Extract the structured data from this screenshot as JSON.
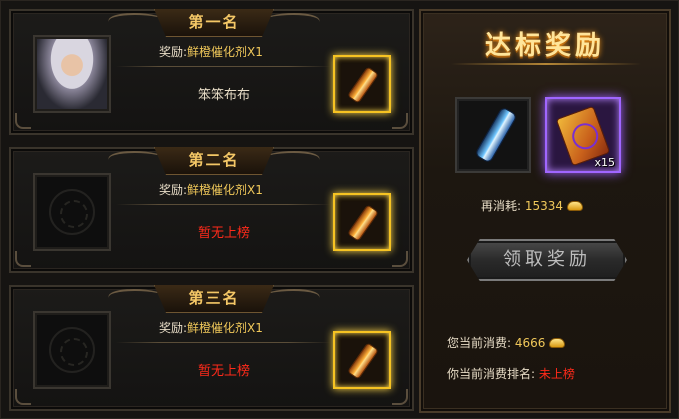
{
  "ranks": [
    {
      "title": "第一名",
      "reward_label": "奖励:",
      "reward_value": "鲜橙催化剂X1",
      "player": "笨笨布布",
      "has_player": true
    },
    {
      "title": "第二名",
      "reward_label": "奖励:",
      "reward_value": "鲜橙催化剂X1",
      "player": "暂无上榜",
      "has_player": false
    },
    {
      "title": "第三名",
      "reward_label": "奖励:",
      "reward_value": "鲜橙催化剂X1",
      "player": "暂无上榜",
      "has_player": false
    }
  ],
  "reward_panel": {
    "title": "达标奖励",
    "items": [
      {
        "icon": "blue-catalyst-tube-icon",
        "qty": ""
      },
      {
        "icon": "purple-scroll-icon",
        "qty": "x15"
      }
    ],
    "cost_label": "再消耗:",
    "cost_value": "15334",
    "claim_label": "领取奖励",
    "current_spend_label": "您当前消费:",
    "current_spend_value": "4666",
    "current_rank_label": "你当前消费排名:",
    "current_rank_value": "未上榜"
  },
  "colors": {
    "gold_text": "#f0c85a",
    "rank_title": "#f4c766",
    "empty_red": "#ff2a1a",
    "epic_purple": "#a066ff"
  }
}
